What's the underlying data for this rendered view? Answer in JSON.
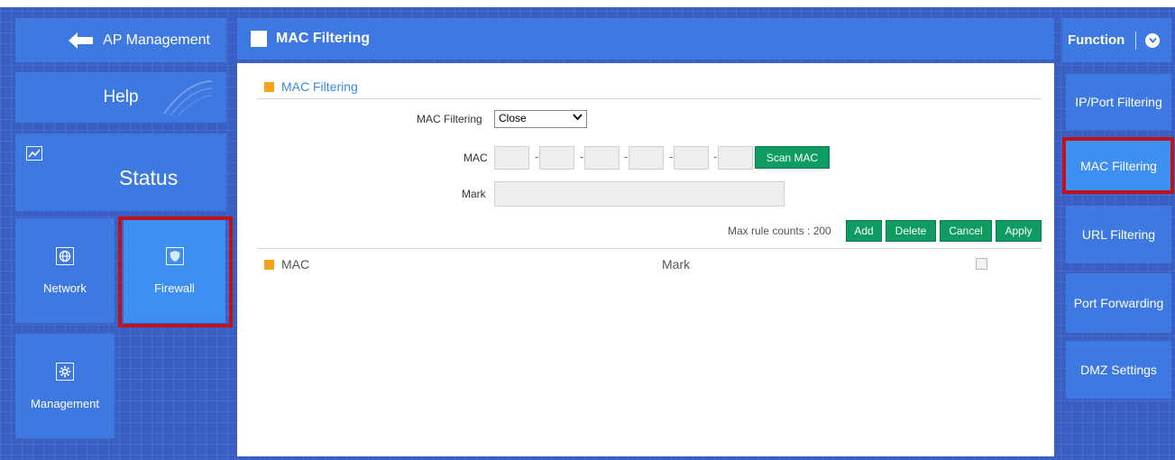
{
  "left_nav": {
    "ap_management": "AP Management",
    "help": "Help",
    "status": "Status",
    "network": "Network",
    "firewall": "Firewall",
    "management": "Management"
  },
  "panel": {
    "header_title": "MAC Filtering",
    "section_title": "MAC Filtering",
    "mac_filtering_label": "MAC Filtering",
    "mac_filtering_value": "Close",
    "mac_label": "MAC",
    "mac_separator": "-",
    "scan_mac_button": "Scan MAC",
    "mark_label": "Mark",
    "max_rule_counts": "Max rule counts : 200",
    "add_button": "Add",
    "delete_button": "Delete",
    "cancel_button": "Cancel",
    "apply_button": "Apply",
    "table_headers": [
      "MAC",
      "Mark"
    ]
  },
  "right_nav": {
    "function_label": "Function",
    "items": [
      "IP/Port Filtering",
      "MAC Filtering",
      "URL Filtering",
      "Port Forwarding",
      "DMZ Settings"
    ],
    "active_item": "MAC Filtering"
  },
  "colors": {
    "background": "#3a5fc4",
    "tile": "#3e79e2",
    "tile_active": "#3d8ff2",
    "green_button": "#0e9c62",
    "highlight_border": "#c0121a",
    "accent_orange": "#f5a21a"
  }
}
